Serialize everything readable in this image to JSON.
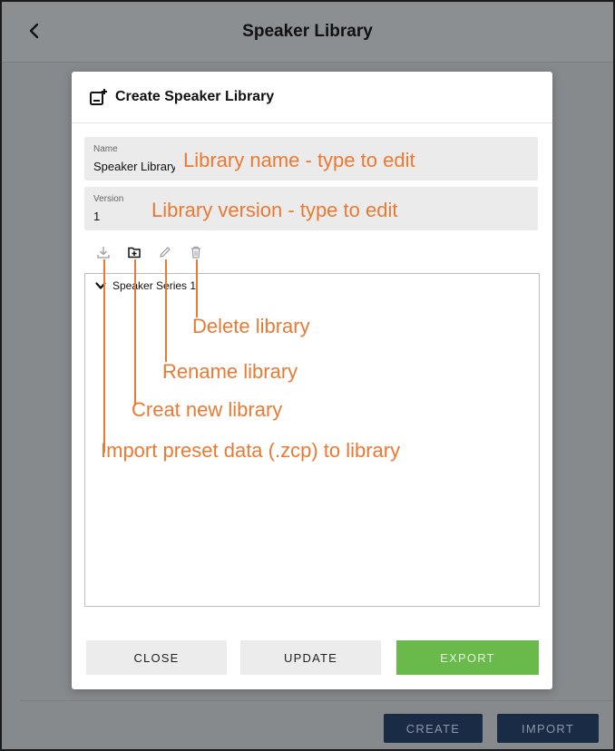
{
  "app": {
    "title": "Speaker Library"
  },
  "dialog": {
    "title": "Create Speaker Library",
    "name_field": {
      "label": "Name",
      "value": "Speaker Library"
    },
    "version_field": {
      "label": "Version",
      "value": "1"
    },
    "toolbar": {
      "import_icon": "download-icon",
      "new_icon": "folder-plus-icon",
      "rename_icon": "pencil-icon",
      "delete_icon": "trash-icon"
    },
    "tree": {
      "items": [
        {
          "label": "Speaker Series 1",
          "expanded": true
        }
      ]
    },
    "buttons": {
      "close": "CLOSE",
      "update": "UPDATE",
      "export": "EXPORT"
    }
  },
  "annotations": {
    "name": "Library name - type to edit",
    "version": "Library version - type to edit",
    "delete": "Delete library",
    "rename": "Rename library",
    "new": "Creat new library",
    "import": "Import preset data (.zcp) to library"
  },
  "footer": {
    "create": "CREATE",
    "import": "IMPORT"
  },
  "colors": {
    "annotation": "#ea7a33",
    "export_button": "#69b94b",
    "footer_button": "#1a2b45",
    "backdrop": "#878a8c"
  }
}
